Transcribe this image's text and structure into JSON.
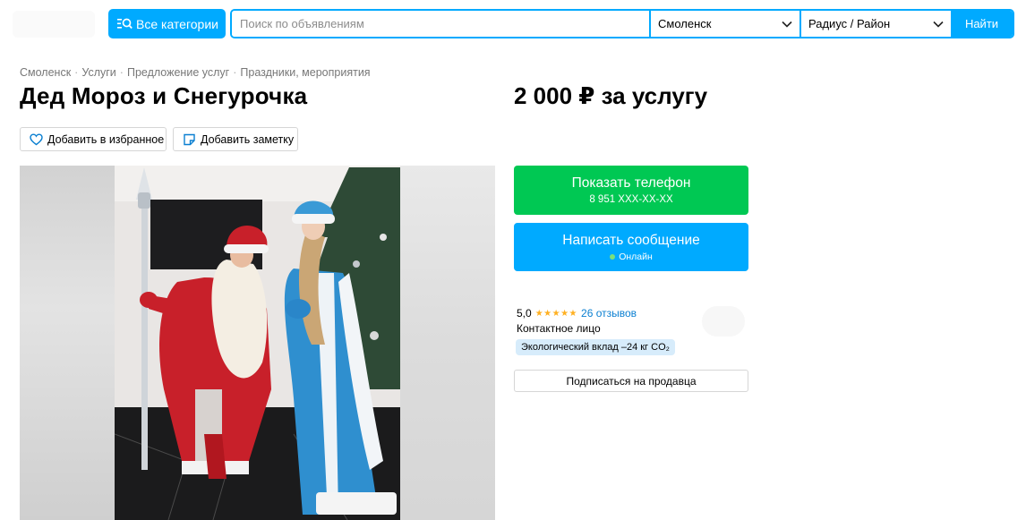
{
  "header": {
    "categories_label": "Все категории",
    "search_placeholder": "Поиск по объявлениям",
    "city": "Смоленск",
    "radius": "Радиус / Район",
    "find_label": "Найти"
  },
  "breadcrumbs": [
    "Смоленск",
    "Услуги",
    "Предложение услуг",
    "Праздники, мероприятия"
  ],
  "listing": {
    "title": "Дед Мороз и Снегурочка",
    "price": "2 000 ₽ за услугу",
    "favorite_label": "Добавить в избранное",
    "note_label": "Добавить заметку"
  },
  "seller": {
    "phone_label": "Показать телефон",
    "phone_masked": "8 951 XXX-XX-XX",
    "message_label": "Написать сообщение",
    "online_status": "Онлайн",
    "rating": "5,0",
    "stars": 5,
    "reviews": "26 отзывов",
    "contact_type": "Контактное лицо",
    "eco_badge": "Экологический вклад –24 кг CO₂",
    "subscribe_label": "Подписаться на продавца"
  },
  "colors": {
    "accent": "#00aaff",
    "phone_button": "#00c853",
    "star": "#ffb021",
    "link": "#0a7fd1"
  }
}
